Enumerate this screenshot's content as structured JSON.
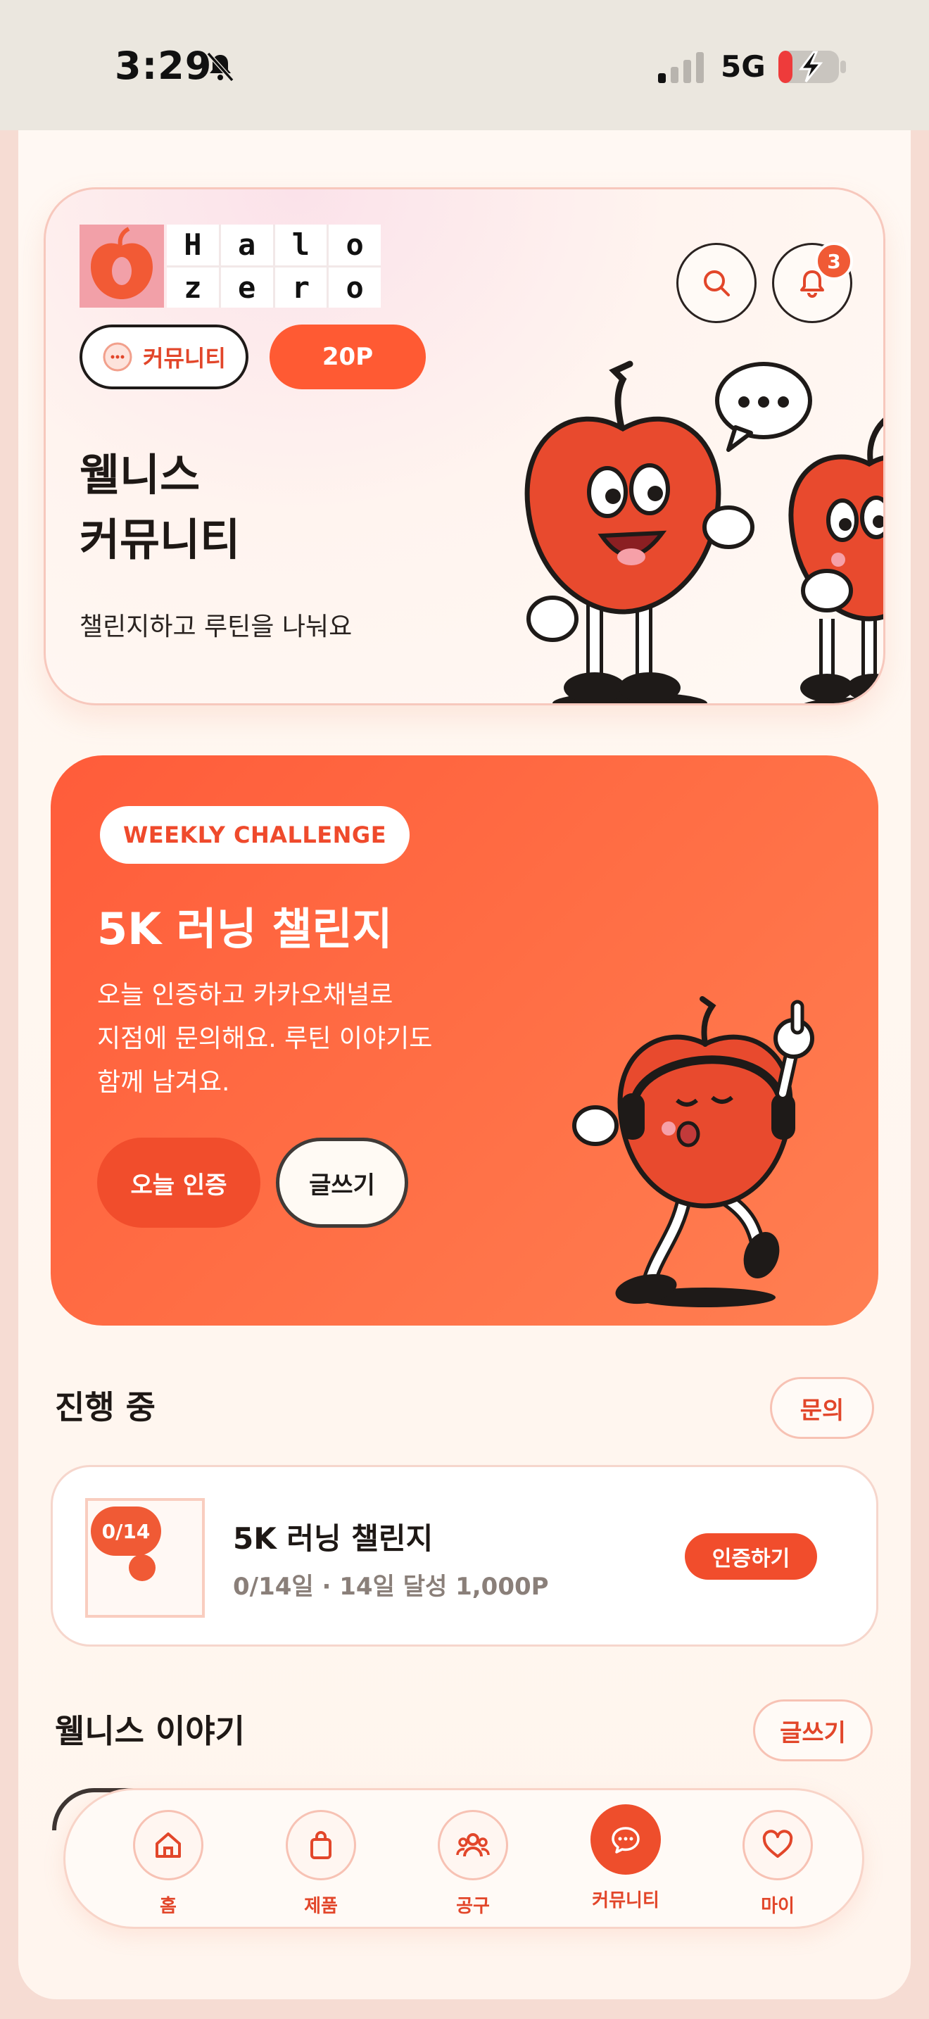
{
  "status_bar": {
    "time": "3:29",
    "network": "5G"
  },
  "header": {
    "logo_letters": [
      "H",
      "a",
      "l",
      "o",
      "z",
      "e",
      "r",
      "o"
    ],
    "notification_count": "3"
  },
  "hero": {
    "community_pill": "커뮤니티",
    "points": "20P",
    "title_line1": "웰니스",
    "title_line2": "커뮤니티",
    "subtitle": "챌린지하고 루틴을 나눠요"
  },
  "challenge": {
    "tag": "WEEKLY CHALLENGE",
    "title": "5K 러닝 챌린지",
    "desc_line1": "오늘 인증하고 카카오채널로",
    "desc_line2": "지점에 문의해요. 루틴 이야기도",
    "desc_line3": "함께 남겨요.",
    "btn_today": "오늘 인증",
    "btn_write": "글쓰기"
  },
  "in_progress": {
    "title": "진행 중",
    "inquiry_btn": "문의",
    "card": {
      "badge": "0/14",
      "title": "5K 러닝 챌린지",
      "meta": "0/14일 · 14일 달성 1,000P",
      "action": "인증하기"
    }
  },
  "stories": {
    "title": "웰니스 이야기",
    "write_btn": "글쓰기"
  },
  "nav": {
    "items": [
      {
        "label": "홈",
        "icon": "home-icon"
      },
      {
        "label": "제품",
        "icon": "bag-icon"
      },
      {
        "label": "공구",
        "icon": "group-icon"
      },
      {
        "label": "커뮤니티",
        "icon": "chat-icon"
      },
      {
        "label": "마이",
        "icon": "heart-icon"
      }
    ],
    "active_index": 3
  },
  "colors": {
    "accent": "#ff5a33",
    "accent_dark": "#ee4e2c",
    "text": "#1e1815"
  }
}
